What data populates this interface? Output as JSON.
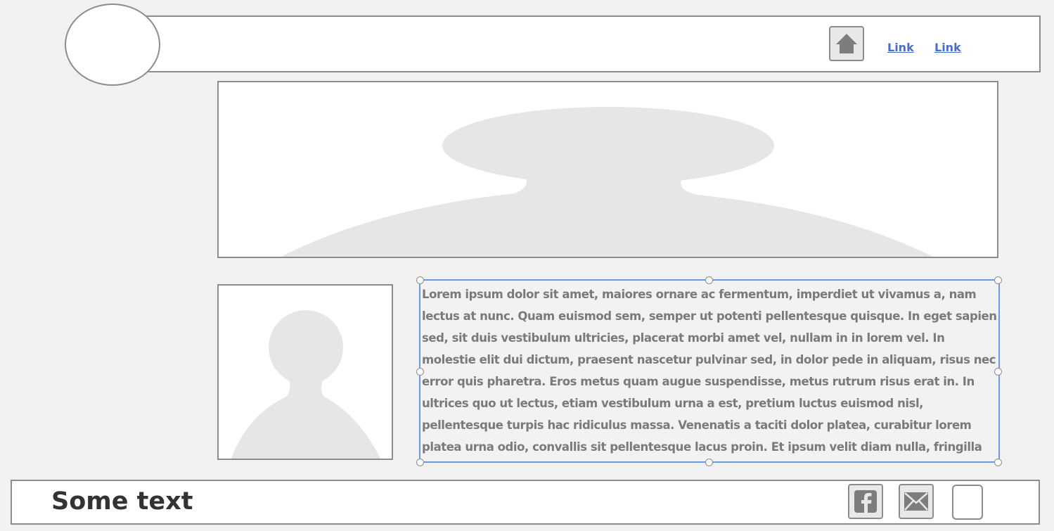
{
  "header": {
    "links": [
      "Link",
      "Link"
    ]
  },
  "content": {
    "paragraph": "Lorem ipsum dolor sit amet, maiores ornare ac fermentum, imperdiet ut vivamus a, nam lectus at nunc. Quam euismod sem, semper ut potenti pellentesque quisque. In eget sapien sed, sit duis vestibulum ultricies, placerat morbi amet vel, nullam in in lorem vel. In molestie elit dui dictum, praesent nascetur pulvinar sed, in dolor pede in aliquam, risus nec error quis pharetra. Eros metus quam augue suspendisse, metus rutrum risus erat in.  In ultrices quo ut lectus, etiam vestibulum urna a est, pretium luctus euismod nisl, pellentesque turpis hac ridiculus massa. Venenatis a taciti dolor platea, curabitur lorem platea urna odio, convallis sit pellentesque lacus proin. Et ipsum velit diam nulla, fringilla"
  },
  "footer": {
    "text": "Some text"
  },
  "icons": {
    "home": "home-icon",
    "facebook": "facebook-icon",
    "mail": "mail-icon"
  },
  "colors": {
    "link": "#4a6ec8",
    "selection": "#6f97e6",
    "border": "#8c8c8c",
    "placeholder": "#e6e6e6"
  }
}
